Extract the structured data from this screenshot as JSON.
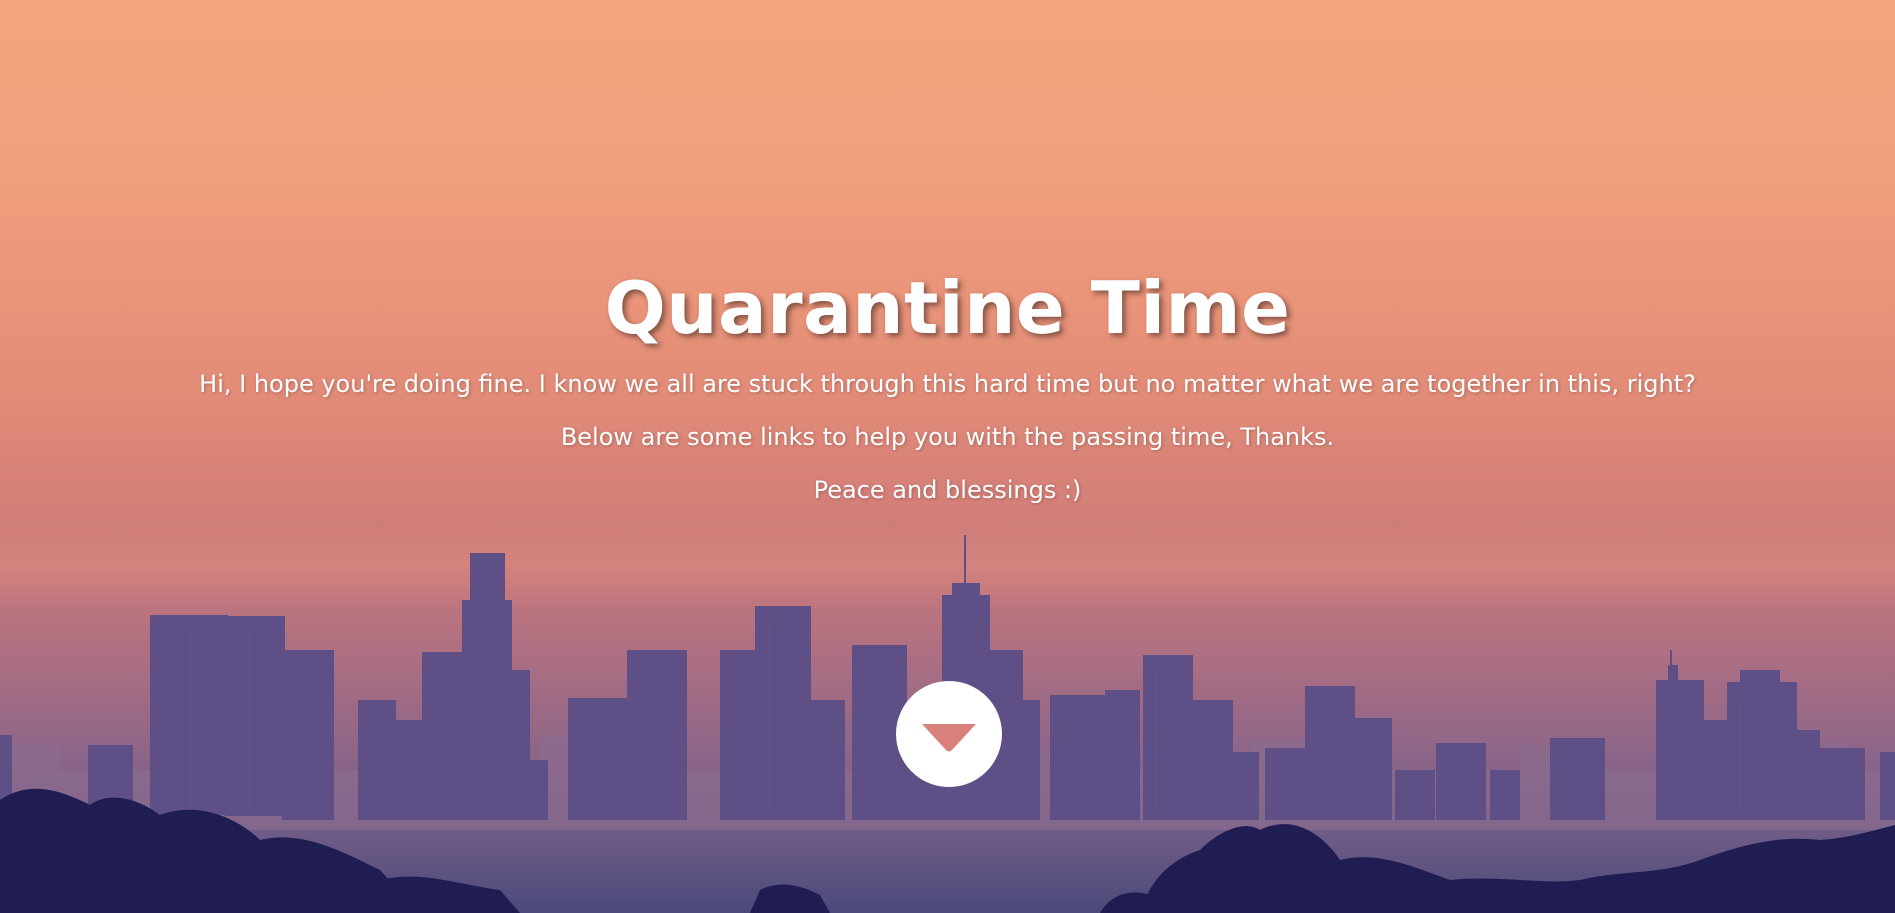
{
  "hero": {
    "title": "Quarantine Time",
    "lines": [
      "Hi, I hope you're doing fine. I know we all are stuck through this hard time but no matter what we are together in this, right?",
      "Below are some links to help you with the passing time, Thanks.",
      "Peace and blessings :)"
    ],
    "scroll_icon": "caret-down-icon",
    "background": "city-skyline-at-sunset"
  },
  "colors": {
    "text": "#ffffff",
    "button_bg": "#ffffff",
    "button_icon": "#d9807c",
    "sky_top": "#f3a67e",
    "buildings": "#5b4f86",
    "trees": "#1f1d52"
  }
}
